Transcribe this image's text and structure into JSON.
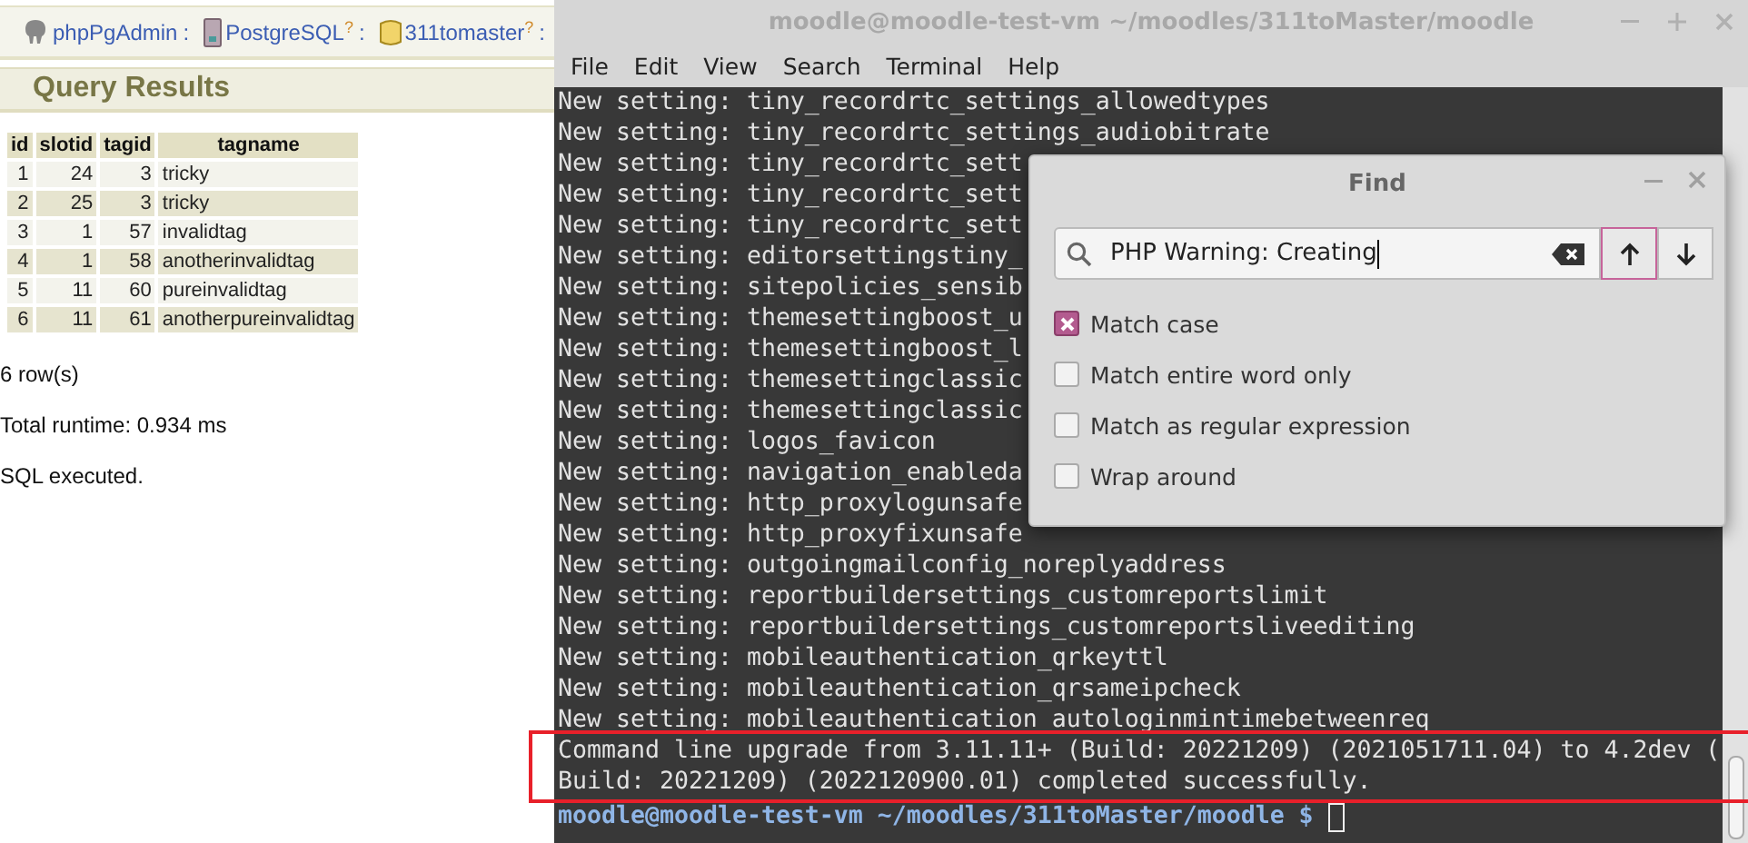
{
  "pgadmin": {
    "breadcrumbs": [
      {
        "kind": "app",
        "label": "phpPgAdmin",
        "suffix": ":"
      },
      {
        "kind": "server",
        "label": "PostgreSQL",
        "help": "?",
        "suffix": ":"
      },
      {
        "kind": "database",
        "label": "311tomaster",
        "help": "?",
        "suffix": ":"
      }
    ],
    "heading": "Query Results",
    "table": {
      "columns": [
        "id",
        "slotid",
        "tagid",
        "tagname"
      ],
      "rows": [
        [
          "1",
          "24",
          "3",
          "tricky"
        ],
        [
          "2",
          "25",
          "3",
          "tricky"
        ],
        [
          "3",
          "1",
          "57",
          "invalidtag"
        ],
        [
          "4",
          "1",
          "58",
          "anotherinvalidtag"
        ],
        [
          "5",
          "11",
          "60",
          "pureinvalidtag"
        ],
        [
          "6",
          "11",
          "61",
          "anotherpureinvalidtag"
        ]
      ]
    },
    "messages": [
      "6 row(s)",
      "Total runtime: 0.934 ms",
      "SQL executed."
    ]
  },
  "terminal": {
    "title": "moodle@moodle-test-vm ~/moodles/311toMaster/moodle",
    "menu": [
      "File",
      "Edit",
      "View",
      "Search",
      "Terminal",
      "Help"
    ],
    "lines": [
      "New setting: tiny_recordrtc_settings_allowedtypes",
      "New setting: tiny_recordrtc_settings_audiobitrate",
      "New setting: tiny_recordrtc_sett",
      "New setting: tiny_recordrtc_sett",
      "New setting: tiny_recordrtc_sett",
      "New setting: editorsettingstiny_",
      "New setting: sitepolicies_sensib",
      "New setting: themesettingboost_u",
      "New setting: themesettingboost_l",
      "New setting: themesettingclassic",
      "New setting: themesettingclassic",
      "New setting: logos_favicon",
      "New setting: navigation_enableda",
      "New setting: http_proxylogunsafe",
      "New setting: http_proxyfixunsafe",
      "New setting: outgoingmailconfig_noreplyaddress",
      "New setting: reportbuildersettings_customreportslimit",
      "New setting: reportbuildersettings_customreportsliveediting",
      "New setting: mobileauthentication_qrkeyttl",
      "New setting: mobileauthentication_qrsameipcheck",
      "New setting: mobileauthentication_autologinmintimebetweenreq",
      "Command line upgrade from 3.11.11+ (Build: 20221209) (2021051711.04) to 4.2dev (",
      "Build: 20221209) (2022120900.01) completed successfully."
    ],
    "prompt": {
      "user_host": "moodle@moodle-test-vm",
      "path": "~/moodles/311toMaster/moodle $"
    }
  },
  "find_dialog": {
    "title": "Find",
    "query": "PHP Warning: Creating",
    "nav": [
      {
        "kind": "up",
        "selected": true
      },
      {
        "kind": "down",
        "selected": false
      }
    ],
    "options": [
      {
        "label": "Match case",
        "checked": true
      },
      {
        "label": "Match entire word only",
        "checked": false
      },
      {
        "label": "Match as regular expression",
        "checked": false
      },
      {
        "label": "Wrap around",
        "checked": false
      }
    ]
  }
}
